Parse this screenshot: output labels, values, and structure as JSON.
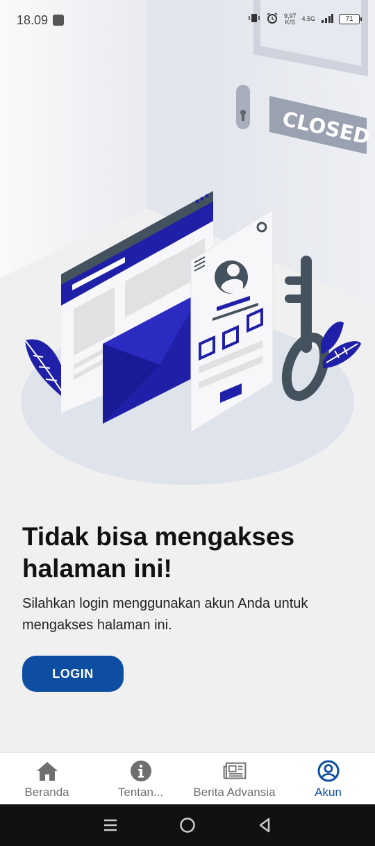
{
  "status_bar": {
    "time": "18.09",
    "net_speed_value": "9,97",
    "net_speed_unit": "K/S",
    "network_type": "4.5G",
    "battery": "71"
  },
  "illustration": {
    "sign_text": "CLOSED"
  },
  "main": {
    "title": "Tidak bisa mengakses halaman ini!",
    "description": "Silahkan login menggunakan akun Anda untuk mengakses halaman ini.",
    "login_label": "LOGIN"
  },
  "bottom_nav": {
    "items": [
      {
        "label": "Beranda",
        "icon": "home-icon"
      },
      {
        "label": "Tentan...",
        "icon": "info-icon"
      },
      {
        "label": "Berita Advansia",
        "icon": "newspaper-icon"
      },
      {
        "label": "Akun",
        "icon": "account-icon"
      }
    ],
    "active_color": "#0d4ea3",
    "inactive_color": "#6f6f6f"
  },
  "colors": {
    "primary": "#0d4ea3",
    "illustration_blue": "#1f1fa8",
    "illustration_dark": "#44525e"
  }
}
